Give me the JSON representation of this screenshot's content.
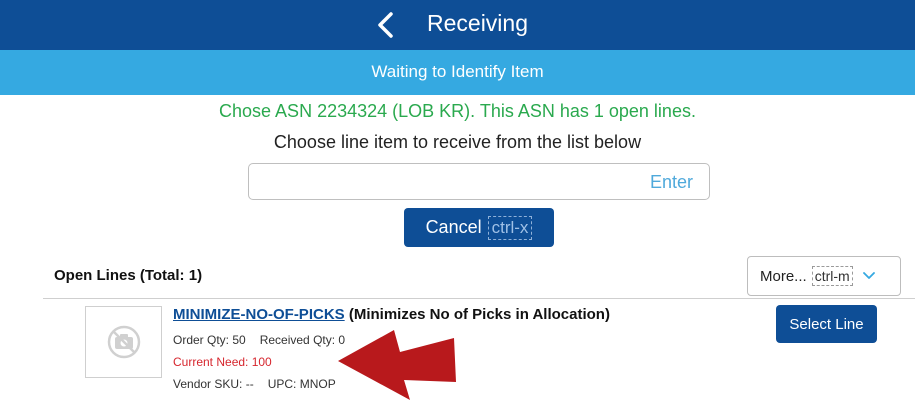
{
  "header": {
    "title": "Receiving",
    "bar_color": "#0e4e96"
  },
  "subheader": {
    "text": "Waiting to Identify Item",
    "bar_color": "#35a9e1"
  },
  "status": {
    "message": "Chose ASN 2234324 (LOB KR). This ASN has 1 open lines.",
    "color": "#2aa94e"
  },
  "instruction": "Choose line item to receive from the list below",
  "scan_input": {
    "value": "",
    "enter_label": "Enter"
  },
  "cancel": {
    "label": "Cancel",
    "shortcut": "ctrl-x"
  },
  "open_lines": {
    "heading": "Open Lines (Total: 1)",
    "more_label": "More...",
    "more_shortcut": "ctrl-m"
  },
  "lines": [
    {
      "item_code": "MINIMIZE-NO-OF-PICKS",
      "description": "(Minimizes No of Picks in Allocation)",
      "order_qty": "Order Qty: 50",
      "received_qty": "Received Qty: 0",
      "current_need": "Current Need: 100",
      "vendor_sku": "Vendor SKU: --",
      "upc": "UPC: MNOP",
      "select_label": "Select Line",
      "image_icon": "no-image-icon"
    }
  ],
  "annotation": {
    "icon": "red-arrow-icon",
    "color": "#b8191c"
  }
}
